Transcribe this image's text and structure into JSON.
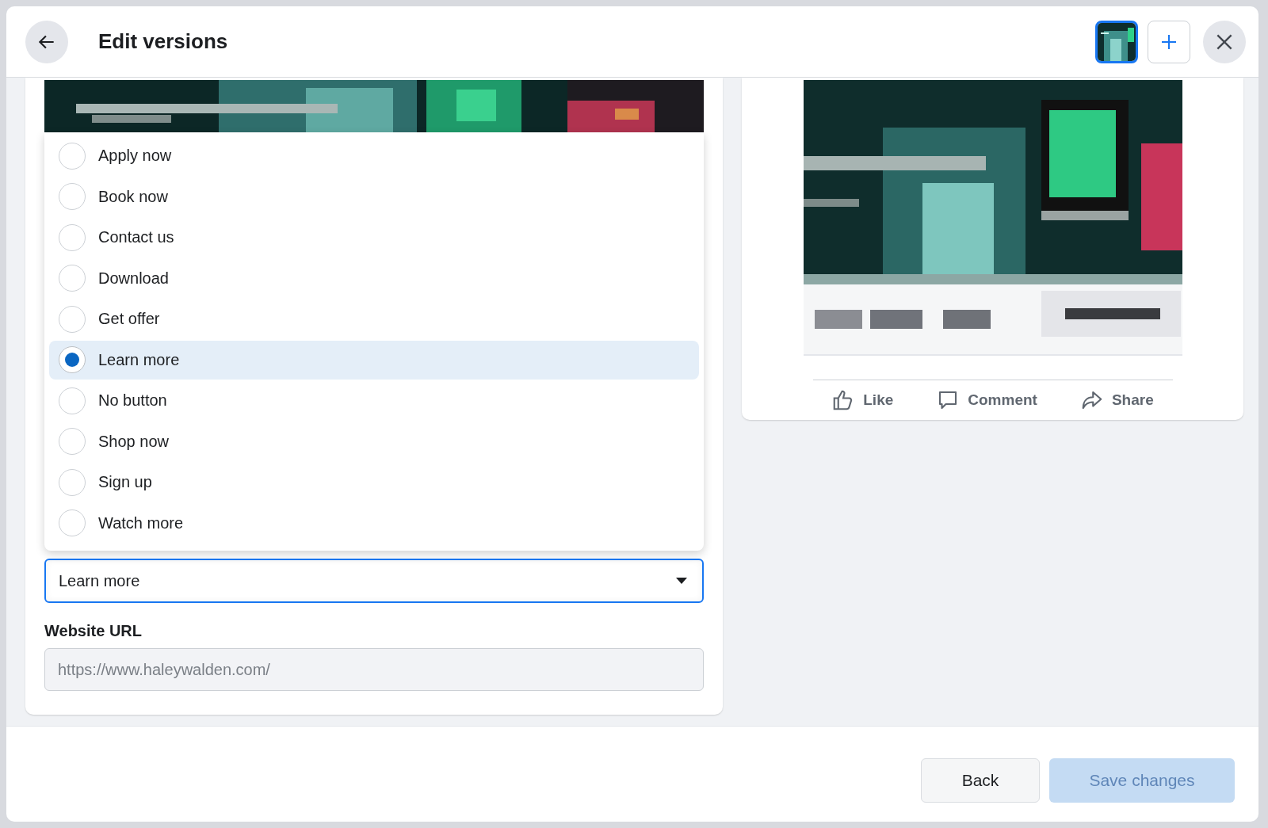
{
  "header": {
    "title": "Edit versions",
    "version_thumbnails": [
      {
        "kind": "picture",
        "selected": true
      }
    ]
  },
  "button_label_menu": {
    "options": [
      {
        "label": "Apply now",
        "selected": false
      },
      {
        "label": "Book now",
        "selected": false
      },
      {
        "label": "Contact us",
        "selected": false
      },
      {
        "label": "Download",
        "selected": false
      },
      {
        "label": "Get offer",
        "selected": false
      },
      {
        "label": "Learn more",
        "selected": true
      },
      {
        "label": "No button",
        "selected": false
      },
      {
        "label": "Shop now",
        "selected": false
      },
      {
        "label": "Sign up",
        "selected": false
      },
      {
        "label": "Watch more",
        "selected": false
      }
    ]
  },
  "button_label_field": {
    "value": "Learn more"
  },
  "website_url": {
    "label": "Website URL",
    "placeholder": "https://www.haleywalden.com/"
  },
  "preview": {
    "actions": [
      {
        "label": "Like",
        "kind": "like"
      },
      {
        "label": "Comment",
        "kind": "comment"
      },
      {
        "label": "Share",
        "kind": "share"
      }
    ]
  },
  "footer": {
    "buttons": [
      {
        "label": "Back",
        "kind": "secondary",
        "disabled": false
      },
      {
        "label": "Save changes",
        "kind": "primary",
        "disabled": true
      }
    ]
  }
}
